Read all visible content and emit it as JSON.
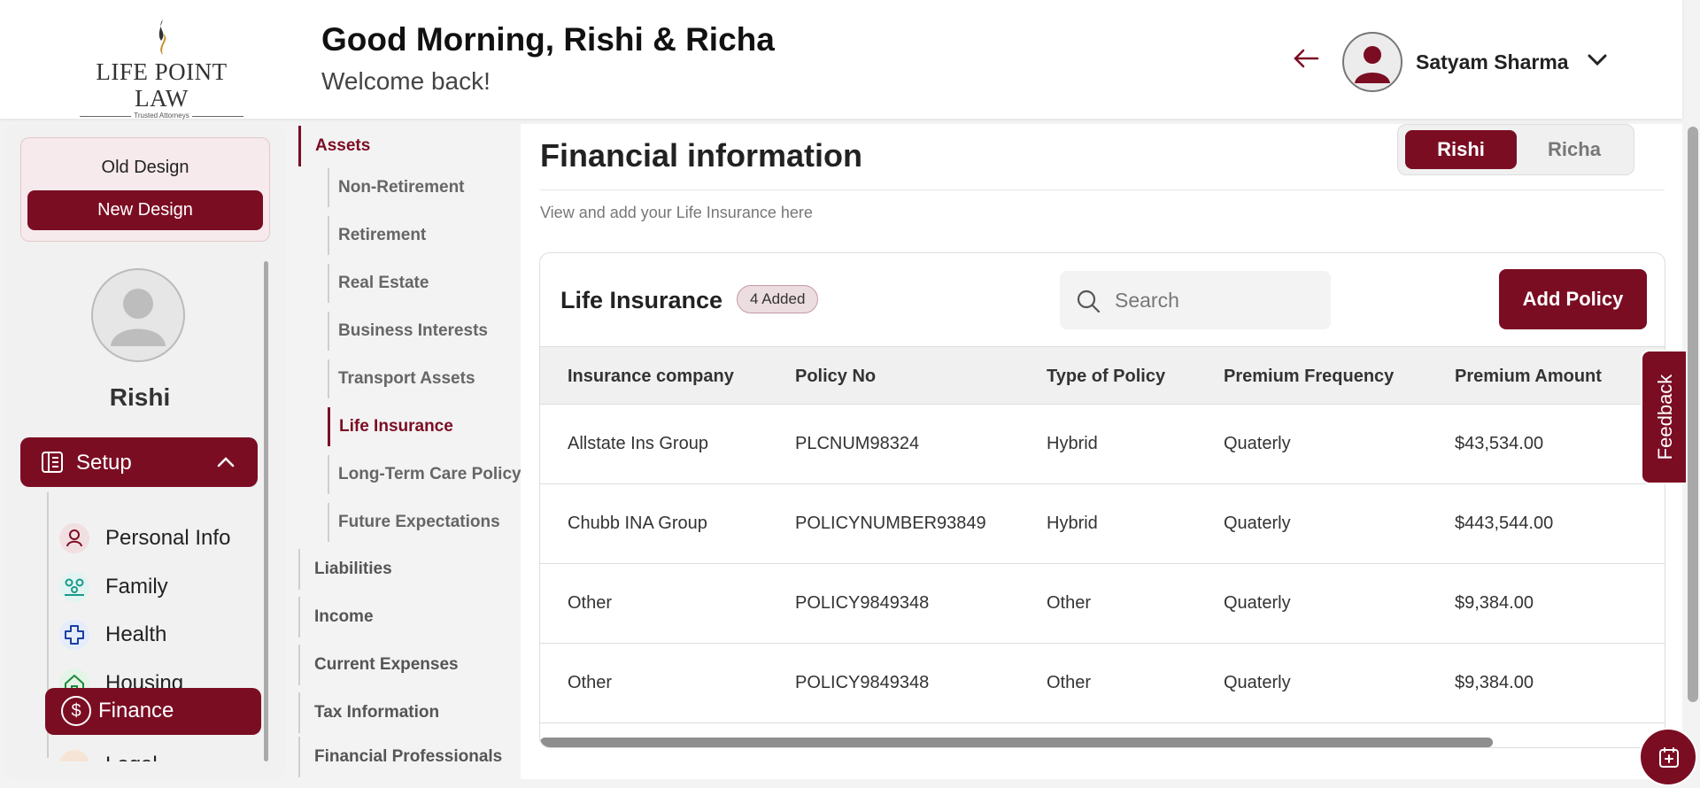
{
  "header": {
    "logo_name": "LIFE POINT LAW",
    "logo_tagline": "Trusted Attorneys",
    "greeting": "Good Morning, Rishi & Richa",
    "welcome": "Welcome back!",
    "user_name": "Satyam Sharma"
  },
  "sidebar": {
    "old_design": "Old Design",
    "new_design": "New Design",
    "profile_name": "Rishi",
    "setup_label": "Setup",
    "items": [
      {
        "label": "Personal Info",
        "icon": "person-icon"
      },
      {
        "label": "Family",
        "icon": "family-icon"
      },
      {
        "label": "Health",
        "icon": "health-cross-icon"
      },
      {
        "label": "Housing",
        "icon": "house-icon"
      },
      {
        "label": "Finance",
        "icon": "dollar-icon"
      },
      {
        "label": "Legal",
        "icon": "legal-icon"
      }
    ]
  },
  "asset_nav": {
    "assets": "Assets",
    "subs": [
      "Non-Retirement",
      "Retirement",
      "Real Estate",
      "Business Interests",
      "Transport Assets",
      "Life Insurance",
      "Long-Term Care Policy",
      "Future Expectations"
    ],
    "mains": [
      "Liabilities",
      "Income",
      "Current Expenses",
      "Tax Information",
      "Financial Professionals"
    ]
  },
  "main": {
    "title": "Financial information",
    "subtitle": "View and add your Life Insurance here",
    "toggle": {
      "rishi": "Rishi",
      "richa": "Richa"
    },
    "card": {
      "title": "Life Insurance",
      "badge": "4 Added",
      "search_placeholder": "Search",
      "add_button": "Add Policy",
      "columns": [
        "Insurance company",
        "Policy No",
        "Type of Policy",
        "Premium Frequency",
        "Premium Amount"
      ],
      "rows": [
        [
          "Allstate Ins Group",
          "PLCNUM98324",
          "Hybrid",
          "Quaterly",
          "$43,534.00"
        ],
        [
          "Chubb INA Group",
          "POLICYNUMBER93849",
          "Hybrid",
          "Quaterly",
          "$443,544.00"
        ],
        [
          "Other",
          "POLICY9849348",
          "Other",
          "Quaterly",
          "$9,384.00"
        ],
        [
          "Other",
          "POLICY9849348",
          "Other",
          "Quaterly",
          "$9,384.00"
        ]
      ]
    }
  },
  "feedback": "Feedback",
  "colors": {
    "brand": "#7b0d23",
    "accent_light": "#f6eaec"
  }
}
